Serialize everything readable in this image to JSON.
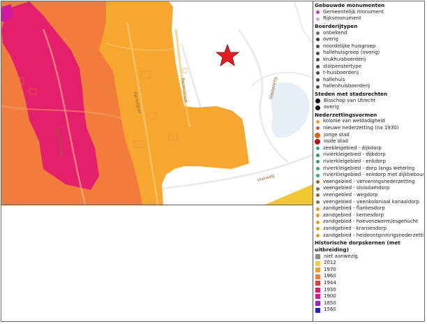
{
  "map": {
    "marker_icon": "red-star-icon",
    "streets": [
      "Bosschenhoek",
      "Kaneelpad",
      "Hasselweg",
      "Vlakweg",
      "Rozenstraat"
    ]
  },
  "legend": {
    "groups": [
      {
        "title": "Gebouwde monumenten",
        "items": [
          {
            "label": "Gemeentelijk monument",
            "shape": "dot",
            "color": "#c03cc8"
          },
          {
            "label": "Rijksmonument",
            "shape": "dot",
            "color": "#d6a6e0"
          }
        ]
      },
      {
        "title": "Boerderijtypen",
        "items": [
          {
            "label": "onbekend",
            "shape": "dot",
            "color": "#6e6e6e"
          },
          {
            "label": "overig",
            "shape": "dot",
            "color": "#3a3a3a"
          },
          {
            "label": "noordelijke huisgroep",
            "shape": "dot",
            "color": "#4a4a4a"
          },
          {
            "label": "hallehuisgroep (overig)",
            "shape": "dot",
            "color": "#4a4a4a"
          },
          {
            "label": "krukhuisboerderij",
            "shape": "dot",
            "color": "#4a4a4a"
          },
          {
            "label": "stolpenstertype",
            "shape": "dot",
            "color": "#4a4a4a"
          },
          {
            "label": "t-huisboerderij",
            "shape": "dot",
            "color": "#4a4a4a"
          },
          {
            "label": "hallehuis",
            "shape": "dot",
            "color": "#4a4a4a"
          },
          {
            "label": "hallenhuisboerderij",
            "shape": "dot",
            "color": "#4a4a4a"
          }
        ]
      },
      {
        "title": "Steden met stadsrechten",
        "items": [
          {
            "label": "Bisschop van Utrecht",
            "shape": "dot-l",
            "color": "#111111"
          },
          {
            "label": "overig",
            "shape": "dot-l",
            "color": "#111111"
          }
        ]
      },
      {
        "title": "Nederzettingsvormen",
        "items": [
          {
            "label": "kolonie van weldadigheid",
            "shape": "dot",
            "color": "#e8a030"
          },
          {
            "label": "nieuwe nederzetting (na 1930)",
            "shape": "dot",
            "color": "#e05050"
          },
          {
            "label": "jonge stad",
            "shape": "dot-xl",
            "color": "#e06418"
          },
          {
            "label": "oude stad",
            "shape": "dot-xl",
            "color": "#b01818"
          },
          {
            "label": "zeekleigebied - dijkdorp",
            "shape": "dot",
            "color": "#2aa89a"
          },
          {
            "label": "rivierkleigebied - dijkdorp",
            "shape": "dot",
            "color": "#27a05a"
          },
          {
            "label": "rivierkleigebied - enkdorp",
            "shape": "dot",
            "color": "#2aa080"
          },
          {
            "label": "rivierkleigebied - dorp langs wetering",
            "shape": "dot",
            "color": "#33a870"
          },
          {
            "label": "rivierkleigebied - enkdorp met dijkbebouwing",
            "shape": "dot",
            "color": "#35a57a"
          },
          {
            "label": "veengebied - verveningsnederzetting",
            "shape": "dot",
            "color": "#8a6a3a"
          },
          {
            "label": "veengebied - sluisdamdorp",
            "shape": "dot",
            "color": "#8a6a3a"
          },
          {
            "label": "veengebied - wegdorp",
            "shape": "dot",
            "color": "#8a6a3a"
          },
          {
            "label": "veengebied - veenkoloniaal kanaaldorp",
            "shape": "dot",
            "color": "#8a6a3a"
          },
          {
            "label": "zandgebied - flankesdorp",
            "shape": "dot",
            "color": "#d4a020"
          },
          {
            "label": "zandgebied - kernesdorp",
            "shape": "dot",
            "color": "#d4a020"
          },
          {
            "label": "zandgebied - hoevenzwerm/esgehucht",
            "shape": "dot",
            "color": "#d4a020"
          },
          {
            "label": "zandgebied - kransesdorp",
            "shape": "dot",
            "color": "#d4a020"
          },
          {
            "label": "zandgebied - heideontginningsnederzetting",
            "shape": "dot",
            "color": "#d4a020"
          }
        ]
      },
      {
        "title": "Historische dorpskernen (met uitbreiding)",
        "items": [
          {
            "label": "niet aanwezig",
            "shape": "sq",
            "color": "#8c8c8c"
          },
          {
            "label": "2012",
            "shape": "sq",
            "color": "#f5d23c"
          },
          {
            "label": "1970",
            "shape": "sq",
            "color": "#f5a030"
          },
          {
            "label": "1960",
            "shape": "sq",
            "color": "#f07838"
          },
          {
            "label": "1944",
            "shape": "sq",
            "color": "#e04040"
          },
          {
            "label": "1930",
            "shape": "sq",
            "color": "#e01a68"
          },
          {
            "label": "1900",
            "shape": "sq",
            "color": "#d01aa0"
          },
          {
            "label": "1850",
            "shape": "sq",
            "color": "#a020c8"
          },
          {
            "label": "1560",
            "shape": "sq",
            "color": "#2020d0"
          }
        ]
      }
    ]
  }
}
